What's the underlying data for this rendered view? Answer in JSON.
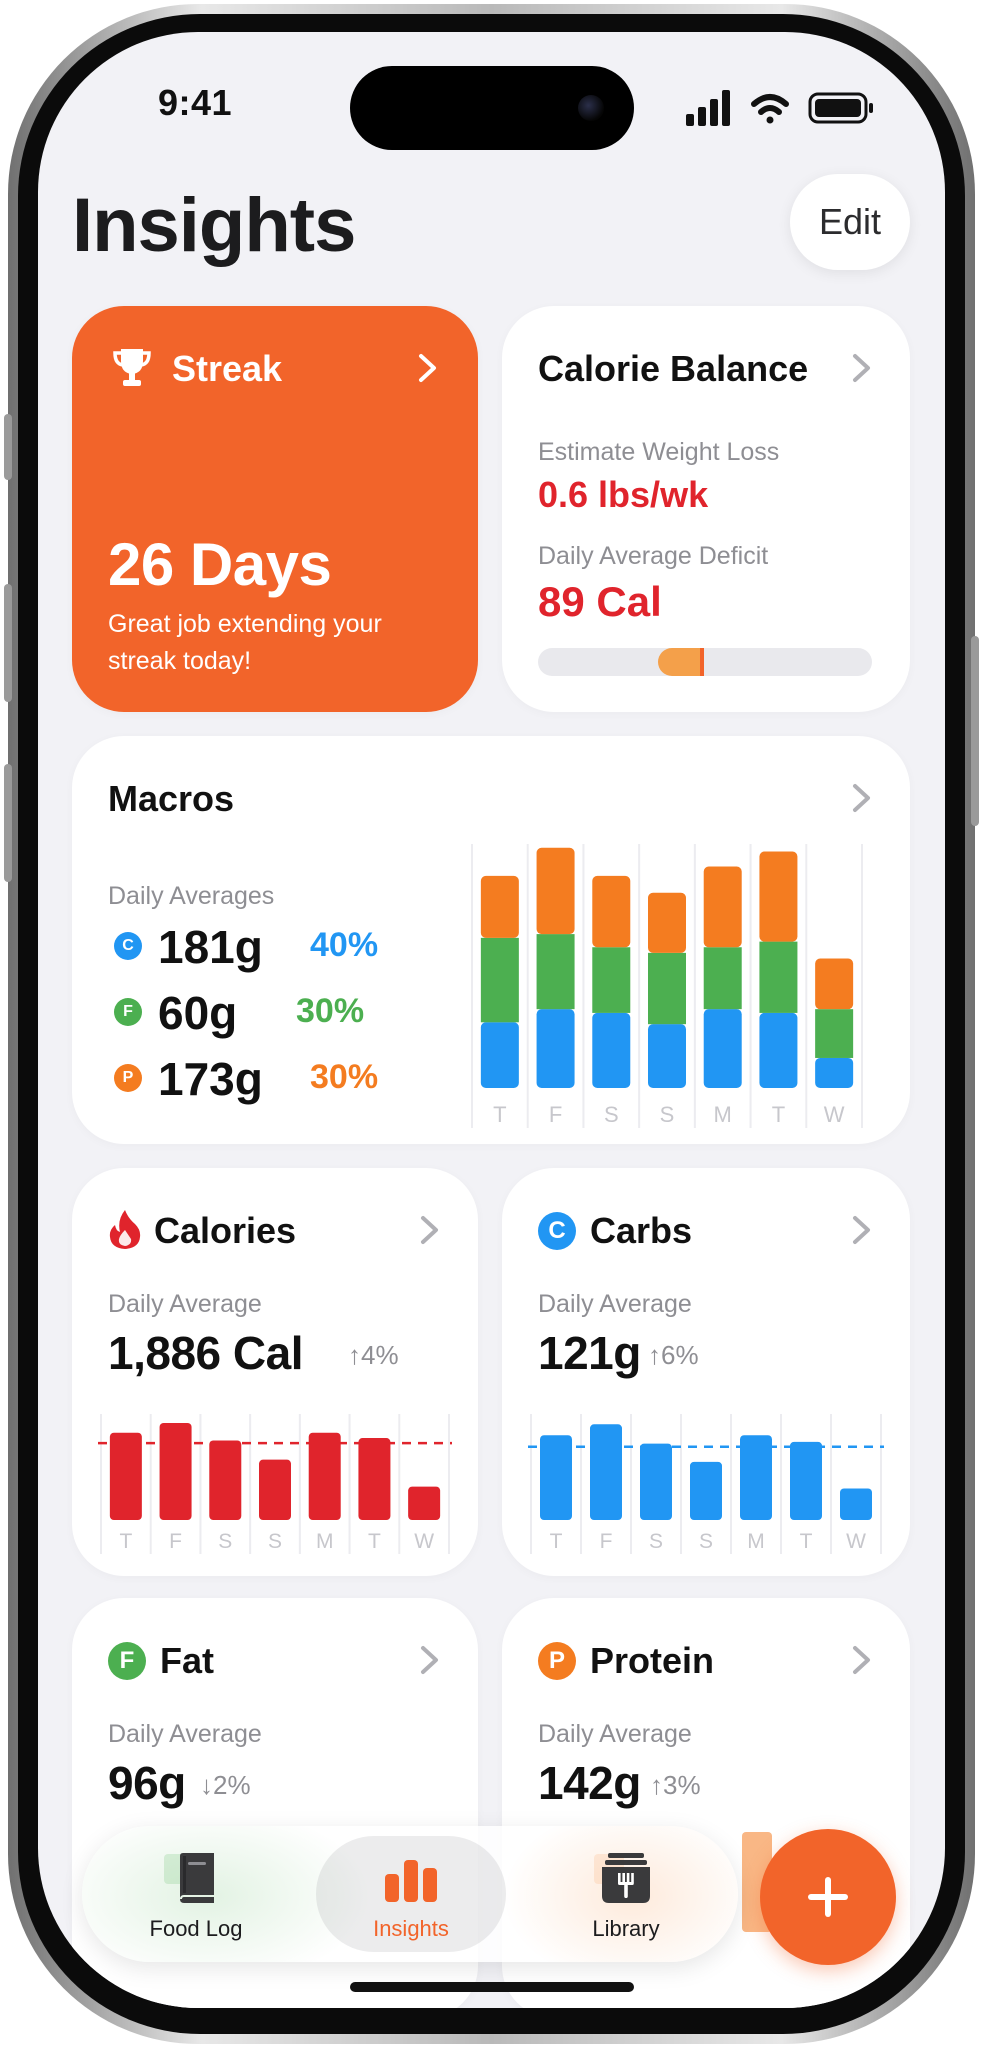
{
  "status_bar": {
    "time": "9:41"
  },
  "header": {
    "title": "Insights",
    "edit_label": "Edit"
  },
  "streak": {
    "title": "Streak",
    "value": "26 Days",
    "message": "Great job extending your streak today!",
    "color": "#f2642a"
  },
  "calorie_balance": {
    "title": "Calorie Balance",
    "weight_label": "Estimate Weight Loss",
    "weight_value": "0.6 lbs/wk",
    "deficit_label": "Daily Average Deficit",
    "deficit_value": "89 Cal",
    "deficit_fraction": 0.1,
    "accent": "#e0242c"
  },
  "macros": {
    "title": "Macros",
    "subtitle": "Daily Averages",
    "items": [
      {
        "badge": "C",
        "grams": "181g",
        "percent": "40%",
        "color": "#2196f3"
      },
      {
        "badge": "F",
        "grams": "60g",
        "percent": "30%",
        "color": "#4caf50"
      },
      {
        "badge": "P",
        "grams": "173g",
        "percent": "30%",
        "color": "#f47c20"
      }
    ]
  },
  "calories_card": {
    "title": "Calories",
    "label": "Daily Average",
    "value": "1,886 Cal",
    "trend": "4%",
    "trend_direction": "up",
    "icon": "flame-icon"
  },
  "carbs_card": {
    "title": "Carbs",
    "badge": "C",
    "label": "Daily Average",
    "value": "121g",
    "trend": "6%",
    "trend_direction": "up"
  },
  "fat_card": {
    "title": "Fat",
    "badge": "F",
    "label": "Daily Average",
    "value": "96g",
    "trend": "2%",
    "trend_direction": "down"
  },
  "protein_card": {
    "title": "Protein",
    "badge": "P",
    "label": "Daily Average",
    "value": "142g",
    "trend": "3%",
    "trend_direction": "up"
  },
  "chart_data": [
    {
      "type": "bar",
      "stacked": true,
      "categories": [
        "T",
        "F",
        "S",
        "S",
        "M",
        "T",
        "W"
      ],
      "series": [
        {
          "color": "#2196f3",
          "values": [
            35,
            42,
            40,
            34,
            42,
            40,
            16
          ]
        },
        {
          "color": "#4caf50",
          "values": [
            45,
            40,
            35,
            38,
            33,
            38,
            26
          ]
        },
        {
          "color": "#f47c20",
          "values": [
            33,
            46,
            38,
            32,
            43,
            48,
            27
          ]
        }
      ],
      "ylim": [
        0,
        130
      ],
      "grid": true
    },
    {
      "type": "bar",
      "categories": [
        "T",
        "F",
        "S",
        "S",
        "M",
        "T",
        "W"
      ],
      "values": [
        2140,
        2380,
        1950,
        1480,
        2140,
        2010,
        820
      ],
      "average_line": 1886,
      "ylim": [
        0,
        2600
      ],
      "color": "#e0242c"
    },
    {
      "type": "bar",
      "categories": [
        "T",
        "F",
        "S",
        "S",
        "M",
        "T",
        "W"
      ],
      "values": [
        140,
        158,
        126,
        96,
        140,
        129,
        52
      ],
      "average_line": 121,
      "ylim": [
        0,
        175
      ],
      "color": "#2196f3"
    }
  ],
  "tab_bar": {
    "items": [
      {
        "label": "Food Log",
        "icon": "book-icon"
      },
      {
        "label": "Insights",
        "icon": "bar-chart-icon"
      },
      {
        "label": "Library",
        "icon": "recipe-box-icon"
      }
    ],
    "active": "Insights",
    "fab_icon": "plus-icon"
  }
}
